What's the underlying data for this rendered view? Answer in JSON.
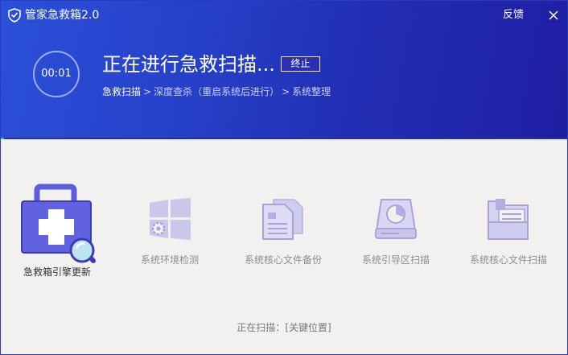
{
  "window": {
    "title": "管家急救箱2.0",
    "feedback_label": "反馈",
    "close_icon": "close-icon",
    "logo_icon": "shield-logo-icon"
  },
  "header": {
    "timer": "00:01",
    "headline": "正在进行急救扫描...",
    "stop_label": "终止",
    "steps": [
      {
        "label": "急救扫描",
        "active": true
      },
      {
        "label": "深度查杀（重启系统后进行）",
        "active": false
      },
      {
        "label": "系统整理",
        "active": false
      }
    ],
    "step_separator": ">"
  },
  "tasks": [
    {
      "label": "急救箱引擎更新",
      "icon": "first-aid-kit-icon",
      "active": true
    },
    {
      "label": "系统环境检测",
      "icon": "windows-settings-icon",
      "active": false
    },
    {
      "label": "系统核心文件备份",
      "icon": "document-copy-icon",
      "active": false
    },
    {
      "label": "系统引导区扫描",
      "icon": "disk-drive-icon",
      "active": false
    },
    {
      "label": "系统核心文件扫描",
      "icon": "folder-icon",
      "active": false
    }
  ],
  "status": {
    "prefix": "正在扫描：",
    "target": "[关键位置]"
  },
  "colors": {
    "header_start": "#2b50d9",
    "header_end": "#1f1ea3",
    "icon_active": "#5d5dde",
    "icon_inactive": "#c5c3e8",
    "progress": "#38c36a"
  }
}
